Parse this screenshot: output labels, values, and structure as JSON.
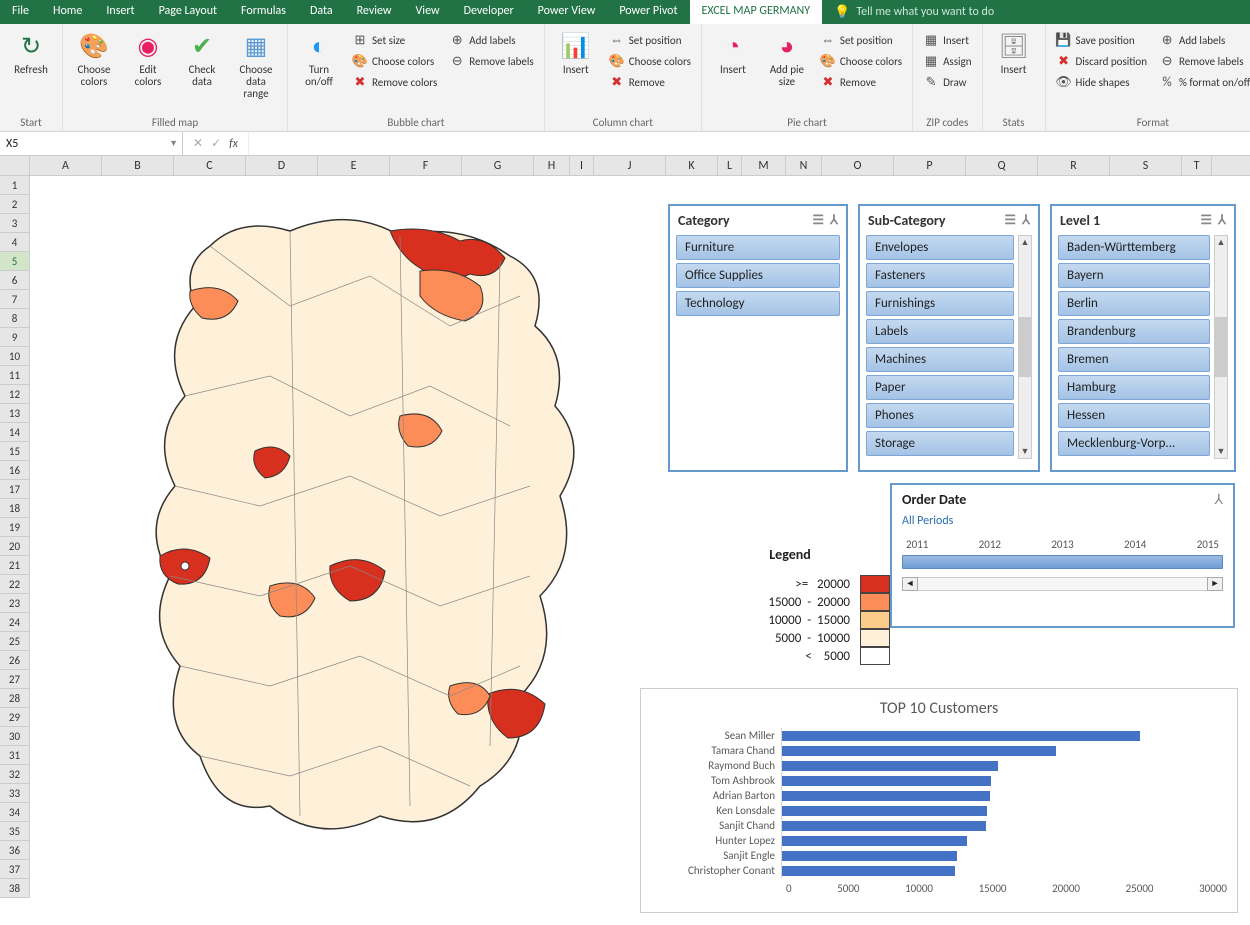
{
  "menubar": {
    "tabs": [
      "File",
      "Home",
      "Insert",
      "Page Layout",
      "Formulas",
      "Data",
      "Review",
      "View",
      "Developer",
      "Power View",
      "Power Pivot",
      "EXCEL MAP GERMANY"
    ],
    "active": "EXCEL MAP GERMANY",
    "tellme": "Tell me what you want to do"
  },
  "ribbon": {
    "groups": [
      {
        "label": "Start",
        "big": [
          {
            "icon": "↻",
            "txt": "Refresh",
            "name": "refresh-button",
            "color": "#217346"
          }
        ],
        "small": []
      },
      {
        "label": "Filled map",
        "big": [
          {
            "icon": "🎨",
            "txt": "Choose colors",
            "name": "choose-colors-button"
          },
          {
            "icon": "◉",
            "txt": "Edit colors",
            "name": "edit-colors-button",
            "color": "#e91e63"
          },
          {
            "icon": "✔",
            "txt": "Check data",
            "name": "check-data-button",
            "color": "#4caf50"
          },
          {
            "icon": "▦",
            "txt": "Choose data range",
            "name": "choose-data-range-button",
            "color": "#5b9bd5"
          }
        ],
        "small": []
      },
      {
        "label": "Bubble chart",
        "big": [
          {
            "icon": "◐",
            "txt": "Turn on/off",
            "name": "bubble-turn-button",
            "color": "#2196f3"
          }
        ],
        "small": [
          {
            "icon": "⊞",
            "txt": "Set size",
            "name": "bubble-setsize"
          },
          {
            "icon": "🎨",
            "txt": "Choose colors",
            "name": "bubble-colors"
          },
          {
            "icon": "✖",
            "txt": "Remove colors",
            "name": "bubble-removecolors",
            "color": "#d32f2f"
          },
          {
            "icon": "⊕",
            "txt": "Add labels",
            "name": "bubble-addlabels"
          },
          {
            "icon": "⊖",
            "txt": "Remove labels",
            "name": "bubble-removelabels"
          }
        ]
      },
      {
        "label": "Column chart",
        "big": [
          {
            "icon": "📊",
            "txt": "Insert",
            "name": "colchart-insert-button"
          }
        ],
        "small": [
          {
            "icon": "⇔",
            "txt": "Set position",
            "name": "colchart-setpos"
          },
          {
            "icon": "🎨",
            "txt": "Choose colors",
            "name": "colchart-colors"
          },
          {
            "icon": "✖",
            "txt": "Remove",
            "name": "colchart-remove",
            "color": "#d32f2f"
          }
        ]
      },
      {
        "label": "Pie chart",
        "big": [
          {
            "icon": "◔",
            "txt": "Insert",
            "name": "pie-insert-button",
            "color": "#e91e63"
          },
          {
            "icon": "◕",
            "txt": "Add pie size",
            "name": "pie-addsize-button",
            "color": "#e91e63"
          }
        ],
        "small": [
          {
            "icon": "⇔",
            "txt": "Set position",
            "name": "pie-setpos"
          },
          {
            "icon": "🎨",
            "txt": "Choose colors",
            "name": "pie-colors"
          },
          {
            "icon": "✖",
            "txt": "Remove",
            "name": "pie-remove",
            "color": "#d32f2f"
          }
        ]
      },
      {
        "label": "ZIP codes",
        "big": [],
        "small": [
          {
            "icon": "▦",
            "txt": "Insert",
            "name": "zip-insert"
          },
          {
            "icon": "▦",
            "txt": "Assign",
            "name": "zip-assign"
          },
          {
            "icon": "✎",
            "txt": "Draw",
            "name": "zip-draw"
          }
        ]
      },
      {
        "label": "Stats",
        "big": [
          {
            "icon": "🗄",
            "txt": "Insert",
            "name": "stats-insert-button",
            "color": "#888"
          }
        ],
        "small": []
      },
      {
        "label": "Format",
        "big": [],
        "small": [
          {
            "icon": "💾",
            "txt": "Save position",
            "name": "fmt-savepos"
          },
          {
            "icon": "✖",
            "txt": "Discard position",
            "name": "fmt-discardpos",
            "color": "#d32f2f"
          },
          {
            "icon": "👁",
            "txt": "Hide shapes",
            "name": "fmt-hideshapes"
          },
          {
            "icon": "⊕",
            "txt": "Add labels",
            "name": "fmt-addlabels"
          },
          {
            "icon": "⊖",
            "txt": "Remove labels",
            "name": "fmt-removelabels"
          },
          {
            "icon": "%",
            "txt": "% format on/off",
            "name": "fmt-percent"
          }
        ]
      }
    ]
  },
  "namebox": "X5",
  "columns": [
    {
      "l": "A",
      "w": 72
    },
    {
      "l": "B",
      "w": 72
    },
    {
      "l": "C",
      "w": 72
    },
    {
      "l": "D",
      "w": 72
    },
    {
      "l": "E",
      "w": 72
    },
    {
      "l": "F",
      "w": 72
    },
    {
      "l": "G",
      "w": 72
    },
    {
      "l": "H",
      "w": 36
    },
    {
      "l": "I",
      "w": 24
    },
    {
      "l": "J",
      "w": 72
    },
    {
      "l": "K",
      "w": 52
    },
    {
      "l": "L",
      "w": 24
    },
    {
      "l": "M",
      "w": 44
    },
    {
      "l": "N",
      "w": 36
    },
    {
      "l": "O",
      "w": 72
    },
    {
      "l": "P",
      "w": 72
    },
    {
      "l": "Q",
      "w": 72
    },
    {
      "l": "R",
      "w": 72
    },
    {
      "l": "S",
      "w": 72
    },
    {
      "l": "T",
      "w": 30
    }
  ],
  "rows": 38,
  "selectedRow": 5,
  "legend": {
    "title": "Legend",
    "items": [
      {
        "label": ">=   20000",
        "cls": "c-red"
      },
      {
        "label": "15000  -  20000",
        "cls": "c-ored"
      },
      {
        "label": "10000  -  15000",
        "cls": "c-or"
      },
      {
        "label": "5000  -  10000",
        "cls": "c-lt"
      },
      {
        "label": "<    5000",
        "cls": "c-wh"
      }
    ]
  },
  "slicers": {
    "category": {
      "title": "Category",
      "items": [
        "Furniture",
        "Office Supplies",
        "Technology"
      ]
    },
    "subcat": {
      "title": "Sub-Category",
      "items": [
        "Envelopes",
        "Fasteners",
        "Furnishings",
        "Labels",
        "Machines",
        "Paper",
        "Phones",
        "Storage"
      ]
    },
    "level1": {
      "title": "Level 1",
      "items": [
        "Baden-Württemberg",
        "Bayern",
        "Berlin",
        "Brandenburg",
        "Bremen",
        "Hamburg",
        "Hessen",
        "Mecklenburg-Vorp..."
      ]
    }
  },
  "timeline": {
    "title": "Order Date",
    "period": "All Periods",
    "years": [
      "2011",
      "2012",
      "2013",
      "2014",
      "2015"
    ]
  },
  "chart_data": {
    "type": "bar",
    "title": "TOP 10 Customers",
    "categories": [
      "Sean Miller",
      "Tamara Chand",
      "Raymond Buch",
      "Tom Ashbrook",
      "Adrian Barton",
      "Ken Lonsdale",
      "Sanjit Chand",
      "Hunter Lopez",
      "Sanjit Engle",
      "Christopher Conant"
    ],
    "values": [
      25000,
      19100,
      15100,
      14600,
      14500,
      14300,
      14200,
      12900,
      12200,
      12100
    ],
    "xlabel": "",
    "ylabel": "",
    "xlim": [
      0,
      30000
    ],
    "xticks": [
      0,
      5000,
      10000,
      15000,
      20000,
      25000,
      30000
    ]
  }
}
